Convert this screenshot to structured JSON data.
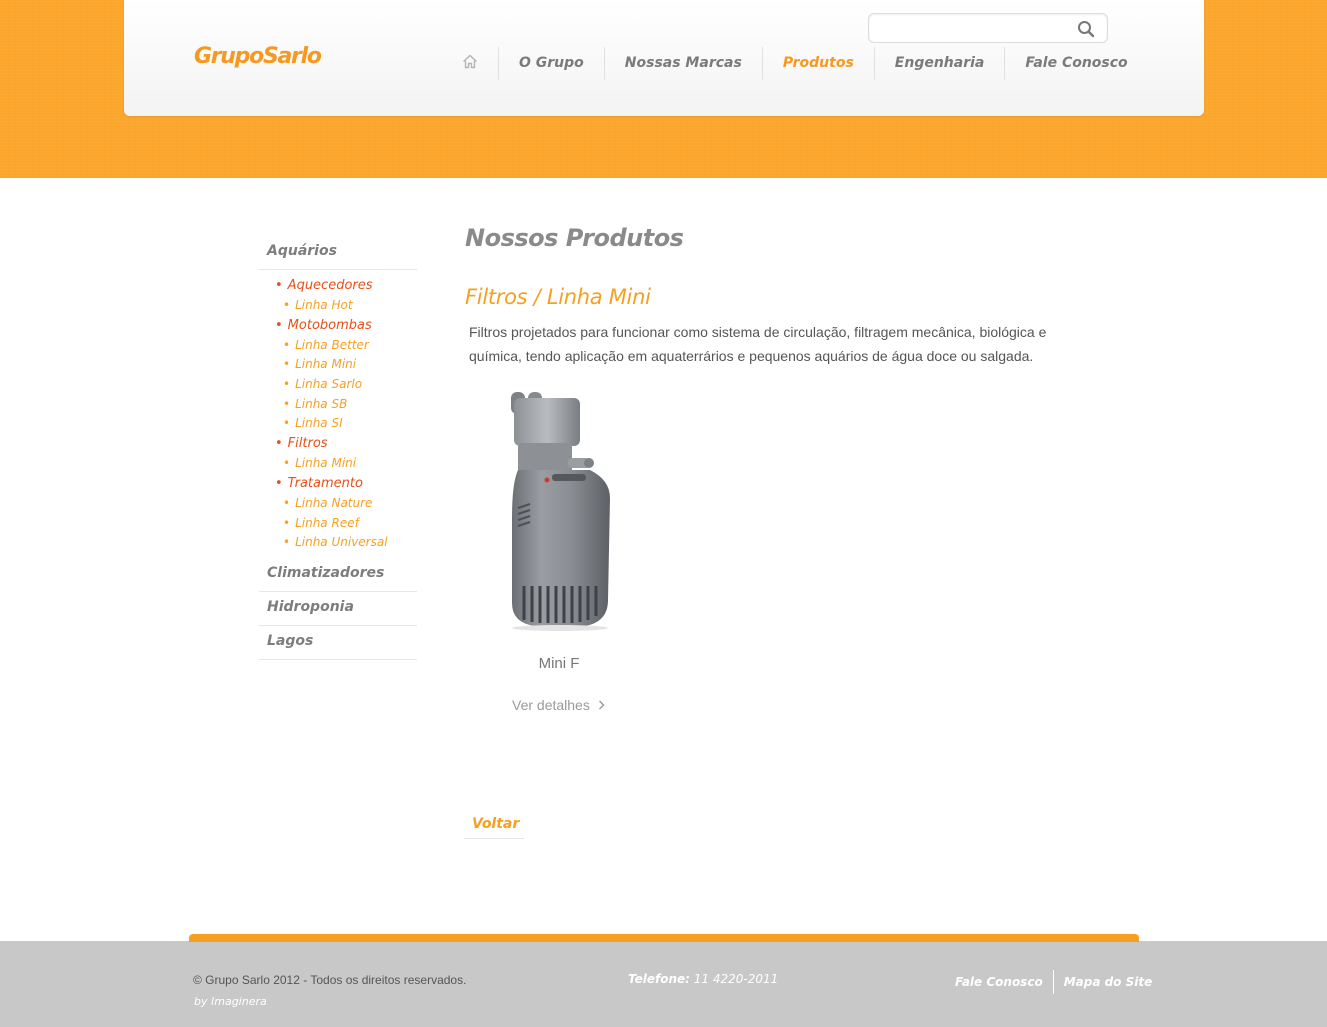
{
  "header": {
    "logo_part1": "Grupo",
    "logo_part2": "Sarlo",
    "search": {
      "placeholder": "",
      "value": "",
      "icon": "search-icon"
    },
    "nav": {
      "home_icon": "home-icon",
      "items": [
        {
          "label": "O Grupo",
          "active": false
        },
        {
          "label": "Nossas Marcas",
          "active": false
        },
        {
          "label": "Produtos",
          "active": true
        },
        {
          "label": "Engenharia",
          "active": false
        },
        {
          "label": "Fale Conosco",
          "active": false
        }
      ]
    }
  },
  "sidebar": {
    "bullet": "•",
    "categories": [
      {
        "label": "Aquários",
        "subcategories": [
          {
            "label": "Aquecedores",
            "lines": [
              "Linha Hot"
            ]
          },
          {
            "label": "Motobombas",
            "lines": [
              "Linha Better",
              "Linha Mini",
              "Linha Sarlo",
              "Linha SB",
              "Linha SI"
            ]
          },
          {
            "label": "Filtros",
            "lines": [
              "Linha Mini"
            ]
          },
          {
            "label": "Tratamento",
            "lines": [
              "Linha Nature",
              "Linha Reef",
              "Linha Universal"
            ]
          }
        ]
      },
      {
        "label": "Climatizadores"
      },
      {
        "label": "Hidroponia"
      },
      {
        "label": "Lagos"
      }
    ]
  },
  "main": {
    "page_title": "Nossos Produtos",
    "section_title": "Filtros / Linha Mini",
    "description": "Filtros projetados para funcionar como sistema de circulação, filtragem mecânica, biológica e química, tendo aplicação em aquaterrários e pequenos aquários de água doce ou salgada.",
    "product": {
      "name": "Mini F",
      "details_label": "Ver detalhes",
      "details_icon": "chevron-right-icon"
    },
    "back_label": "Voltar"
  },
  "footer": {
    "copyright": "© Grupo Sarlo 2012 - Todos os direitos reservados.",
    "by": "by Imaginera",
    "phone_label": "Telefone:",
    "phone_number": " 11 4220-2011",
    "links": [
      "Fale Conosco",
      "Mapa do Site"
    ]
  },
  "colors": {
    "brand_orange": "#fba52a",
    "accent_orange": "#f7a020",
    "link_red": "#e8501a",
    "nav_gray": "#7a7a7a",
    "footer_gray": "#c8c8c8"
  }
}
